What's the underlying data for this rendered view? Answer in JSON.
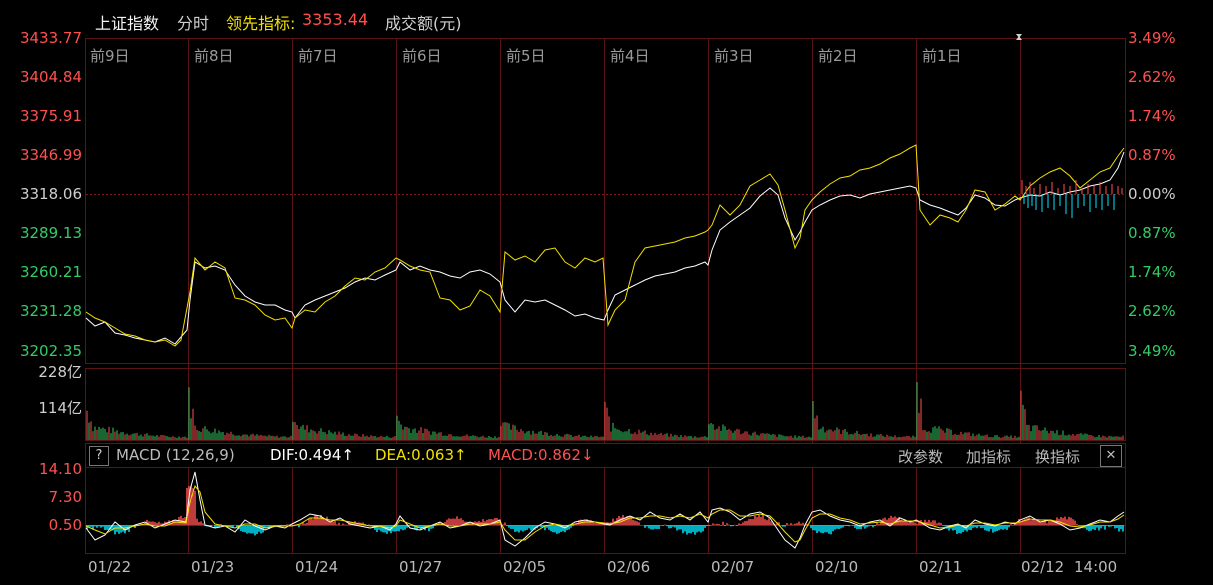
{
  "header": {
    "index_name": "上证指数",
    "mode": "分时",
    "lead_label": "领先指标:",
    "lead_value": "3353.44",
    "volume_label": "成交额(元)"
  },
  "price_axis_left": [
    "3433.77",
    "3404.84",
    "3375.91",
    "3346.99",
    "3318.06",
    "3289.13",
    "3260.21",
    "3231.28",
    "3202.35"
  ],
  "price_axis_right": [
    "3.49%",
    "2.62%",
    "1.74%",
    "0.87%",
    "0.00%",
    "0.87%",
    "1.74%",
    "2.62%",
    "3.49%"
  ],
  "day_labels": [
    "前9日",
    "前8日",
    "前7日",
    "前6日",
    "前5日",
    "前4日",
    "前3日",
    "前2日",
    "前1日"
  ],
  "volume_axis": [
    "228亿",
    "114亿"
  ],
  "macd": {
    "help": "?",
    "name": "MACD (12,26,9)",
    "dif": "DIF:0.494↑",
    "dea": "DEA:0.063↑",
    "macd": "MACD:0.862↓",
    "axis": [
      "14.10",
      "7.30",
      "0.50"
    ],
    "btn_params": "改参数",
    "btn_add": "加指标",
    "btn_switch": "换指标",
    "btn_close": "✕"
  },
  "date_labels": [
    "01/22",
    "01/23",
    "01/24",
    "01/27",
    "02/05",
    "02/06",
    "02/07",
    "02/10",
    "02/11",
    "02/12"
  ],
  "last_time": "14:00",
  "colors": {
    "up": "#ff5050",
    "down": "#33cc66",
    "white_line": "#ffffff",
    "yellow_line": "#f2e000",
    "cyan": "#00e5ff",
    "grid": "#5a1414"
  }
}
